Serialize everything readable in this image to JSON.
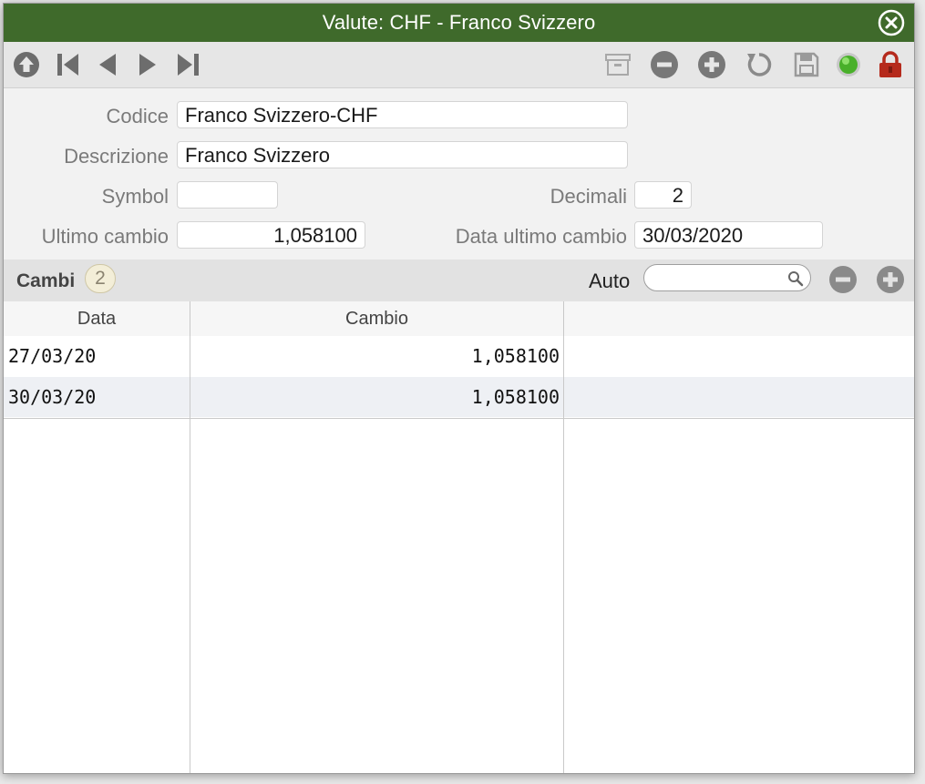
{
  "window": {
    "title": "Valute: CHF - Franco Svizzero"
  },
  "toolbar": {
    "nav_icons": [
      "up-icon",
      "first-icon",
      "previous-icon",
      "next-icon",
      "last-icon"
    ],
    "action_icons": [
      "archive-icon",
      "minus-icon",
      "plus-icon",
      "refresh-icon",
      "save-icon",
      "status-icon",
      "lock-icon"
    ],
    "colors": {
      "accent_green": "#3f6a2b",
      "status_green": "#49b02a",
      "lock_red": "#b52a1c"
    }
  },
  "form": {
    "codice_label": "Codice",
    "codice_value": "Franco Svizzero-CHF",
    "descrizione_label": "Descrizione",
    "descrizione_value": "Franco Svizzero",
    "symbol_label": "Symbol",
    "symbol_value": "",
    "decimali_label": "Decimali",
    "decimali_value": "2",
    "ultimo_cambio_label": "Ultimo cambio",
    "ultimo_cambio_value": "1,058100",
    "data_ultimo_cambio_label": "Data ultimo cambio",
    "data_ultimo_cambio_value": "30/03/2020"
  },
  "cambi": {
    "title": "Cambi",
    "count": "2",
    "auto_label": "Auto",
    "search_value": ""
  },
  "grid": {
    "columns": [
      "Data",
      "Cambio",
      ""
    ],
    "rows": [
      {
        "data": "27/03/20",
        "cambio": "1,058100"
      },
      {
        "data": "30/03/20",
        "cambio": "1,058100"
      }
    ]
  }
}
